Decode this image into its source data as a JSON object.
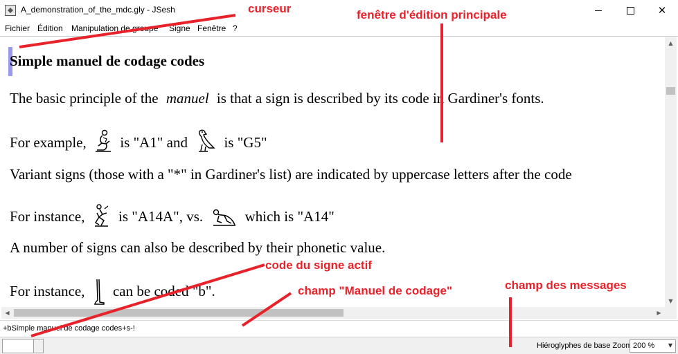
{
  "window": {
    "title": "A_demonstration_of_the_mdc.gly - JSesh"
  },
  "menu": {
    "items": [
      "Fichier",
      "Édition",
      "Manipulation de groupe",
      "Signe",
      "Fenêtre",
      "?"
    ]
  },
  "editor": {
    "title": "Simple manuel de codage codes",
    "line1_a": "The basic principle of the",
    "line1_em": "manuel",
    "line1_b": "is that a sign is described by its code in Gardiner's fonts.",
    "line2_a": "For example,",
    "line2_b": "is \"A1\" and",
    "line2_c": "is \"G5\"",
    "line3": "Variant signs (those with a \"*\" in Gardiner's list) are indicated by uppercase letters after the code",
    "line4_a": "For instance,",
    "line4_b": "is \"A14A\", vs.",
    "line4_c": "which is \"A14\"",
    "line5": "A number of signs can also be described by their phonetic value.",
    "line6_a": "For instance,",
    "line6_b": "can be coded \"b\"."
  },
  "mdc_field": {
    "value": "+bSimple manuel de codage codes+s-!"
  },
  "statusbar": {
    "label": "Hiéroglyphes de base Zoom",
    "zoom": "200 %"
  },
  "annotations": {
    "curseur": "curseur",
    "fenetre": "fenêtre d'édition principale",
    "code_signe": "code du signe actif",
    "champ_mdc": "champ \"Manuel de codage\"",
    "champ_messages": "champ des messages"
  },
  "colors": {
    "annotation": "#e8222a",
    "caret": "#9999ee"
  },
  "icons": [
    "app-icon",
    "minimize-icon",
    "maximize-icon",
    "close-icon",
    "hieroglyph-a1-icon",
    "hieroglyph-g5-icon",
    "hieroglyph-a14a-icon",
    "hieroglyph-a14-icon",
    "hieroglyph-b-icon"
  ]
}
